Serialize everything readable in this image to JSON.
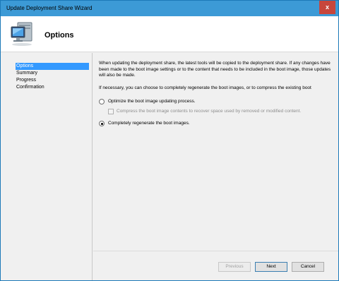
{
  "window": {
    "title": "Update Deployment Share Wizard",
    "close_label": "x",
    "colors": {
      "titlebar": "#3c9ad6",
      "close": "#c7463c",
      "selection": "#3399ff"
    }
  },
  "header": {
    "title": "Options",
    "icon": "computer-monitor-icon"
  },
  "nav": {
    "items": [
      {
        "label": "Options",
        "active": true
      },
      {
        "label": "Summary",
        "active": false
      },
      {
        "label": "Progress",
        "active": false
      },
      {
        "label": "Confirmation",
        "active": false
      }
    ]
  },
  "content": {
    "paragraph1": "When updating the deployment share, the latest tools will be copied to the deployment share.  If any changes have been made to the boot image settings or to the content that needs to be included in the boot image, those updates will also be made.",
    "paragraph2": "If necessary, you can choose to completely regenerate the boot images, or to compress the existing boot",
    "options": [
      {
        "label": "Optimize the boot image updating process.",
        "selected": false
      },
      {
        "label": "Completely regenerate the boot images.",
        "selected": true
      }
    ],
    "compress_checkbox": {
      "label": "Compress the boot image contents to recover space used by removed or modified content.",
      "checked": false,
      "enabled": false
    }
  },
  "buttons": {
    "previous": "Previous",
    "next": "Next",
    "cancel": "Cancel"
  }
}
